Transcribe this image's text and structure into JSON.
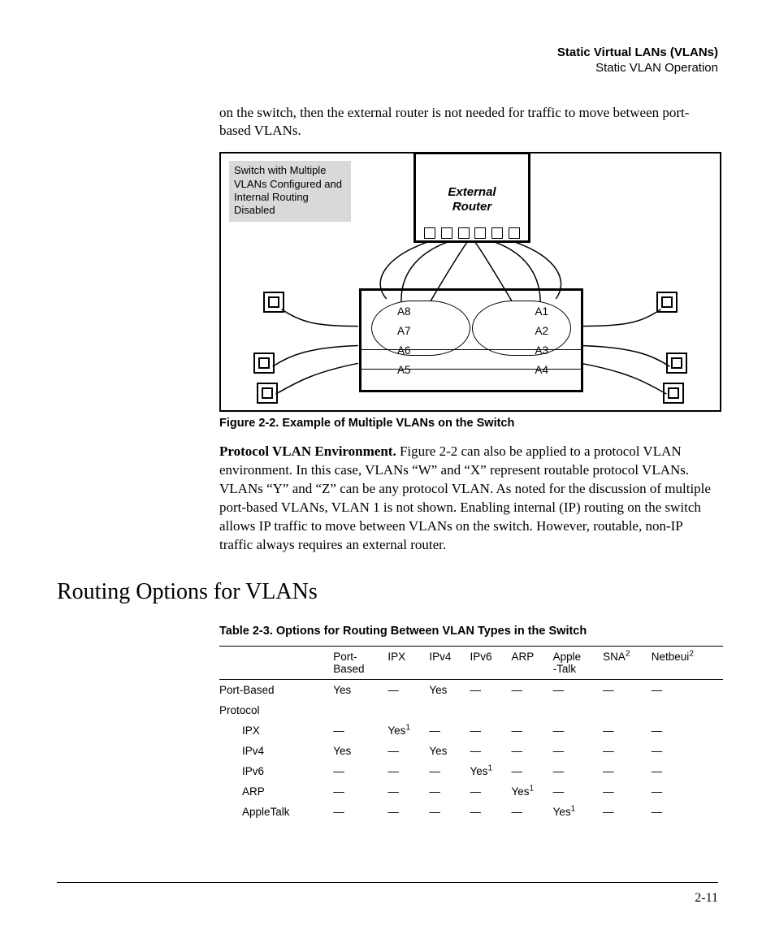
{
  "header": {
    "title": "Static Virtual LANs (VLANs)",
    "subtitle": "Static VLAN Operation"
  },
  "intro": "on the switch, then the external router is not needed for traffic to move between port-based VLANs.",
  "figure": {
    "annotation": "Switch with Multiple VLANs Configured and Internal Routing Disabled",
    "router_l1": "External",
    "router_l2": "Router",
    "ports_left": [
      "A8",
      "A7",
      "A6",
      "A5"
    ],
    "ports_right": [
      "A1",
      "A2",
      "A3",
      "A4"
    ],
    "caption": "Figure 2-2.  Example of Multiple VLANs on the Switch"
  },
  "para2": {
    "runin": "Protocol VLAN Environment.  ",
    "rest": "Figure 2-2 can also be applied to a protocol VLAN environment. In this case, VLANs “W” and “X” represent routable protocol VLANs. VLANs “Y” and “Z” can be any protocol VLAN. As noted for the discussion of multiple port-based VLANs, VLAN 1 is not shown. Enabling internal (IP) routing on the switch allows IP traffic to move between VLANs on the switch. However, routable, non-IP traffic always requires an external router."
  },
  "section_heading": "Routing Options for VLANs",
  "table": {
    "caption": "Table 2-3.  Options for Routing Between VLAN Types in the Switch",
    "cols": [
      "",
      "Port-\nBased",
      "IPX",
      "IPv4",
      "IPv6",
      "ARP",
      "Apple\n-Talk",
      "SNA",
      "Netbeui"
    ],
    "col_sup": [
      "",
      "",
      "",
      "",
      "",
      "",
      "",
      "2",
      "2"
    ],
    "rows": [
      {
        "label": "Port-Based",
        "indent": false,
        "cells": [
          "Yes",
          "—",
          "Yes",
          "—",
          "—",
          "—",
          "—",
          "—"
        ],
        "sup": [
          "",
          "",
          "",
          "",
          "",
          "",
          "",
          ""
        ]
      },
      {
        "label": "Protocol",
        "indent": false,
        "cells": [
          "",
          "",
          "",
          "",
          "",
          "",
          "",
          ""
        ],
        "sup": [
          "",
          "",
          "",
          "",
          "",
          "",
          "",
          ""
        ]
      },
      {
        "label": "IPX",
        "indent": true,
        "cells": [
          "—",
          "Yes",
          "—",
          "—",
          "—",
          "—",
          "—",
          "—"
        ],
        "sup": [
          "",
          "1",
          "",
          "",
          "",
          "",
          "",
          ""
        ]
      },
      {
        "label": "IPv4",
        "indent": true,
        "cells": [
          "Yes",
          "—",
          "Yes",
          "—",
          "—",
          "—",
          "—",
          "—"
        ],
        "sup": [
          "",
          "",
          "",
          "",
          "",
          "",
          "",
          ""
        ]
      },
      {
        "label": "IPv6",
        "indent": true,
        "cells": [
          "—",
          "—",
          "—",
          "Yes",
          "—",
          "—",
          "—",
          "—"
        ],
        "sup": [
          "",
          "",
          "",
          "1",
          "",
          "",
          "",
          ""
        ]
      },
      {
        "label": "ARP",
        "indent": true,
        "cells": [
          "—",
          "—",
          "—",
          "—",
          "Yes",
          "—",
          "—",
          "—"
        ],
        "sup": [
          "",
          "",
          "",
          "",
          "1",
          "",
          "",
          ""
        ]
      },
      {
        "label": "AppleTalk",
        "indent": true,
        "cells": [
          "—",
          "—",
          "—",
          "—",
          "—",
          "Yes",
          "—",
          "—"
        ],
        "sup": [
          "",
          "",
          "",
          "",
          "",
          "1",
          "",
          ""
        ]
      }
    ]
  },
  "page_number": "2-11"
}
